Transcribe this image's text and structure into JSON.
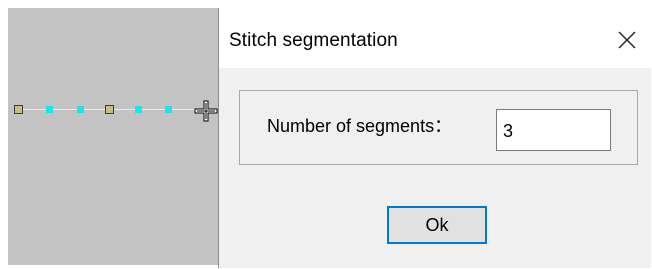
{
  "dialog": {
    "title": "Stitch segmentation",
    "close_icon": "close-icon",
    "segments_label": "Number of segments：",
    "segments_value": "3",
    "ok_label": "Ok"
  },
  "canvas": {
    "background": "#c3c3c3",
    "node_square_color": "#c7c07a",
    "node_dot_color": "#18e6ee",
    "cursor_icon": "crosshair-icon"
  },
  "colors": {
    "accent": "#0078d7",
    "dialog_bg": "#f0f0f0"
  }
}
